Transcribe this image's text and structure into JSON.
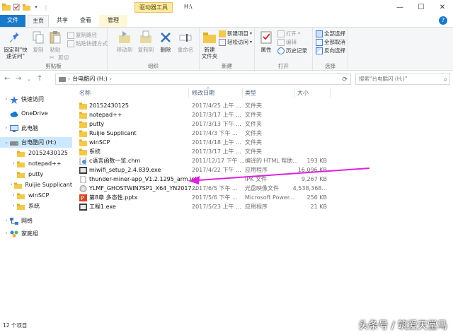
{
  "window": {
    "title": "H:\\",
    "context_tab": "驱动器工具"
  },
  "tabs": {
    "file": "文件",
    "home": "主页",
    "share": "共享",
    "view": "查看",
    "manage": "管理"
  },
  "ribbon": {
    "clipboard": {
      "label": "剪贴板",
      "pin": "固定到\"快速访问\"",
      "copy": "复制",
      "paste": "粘贴",
      "copy_path": "复制路径",
      "paste_shortcut": "粘贴快捷方式",
      "cut": "剪切"
    },
    "organize": {
      "label": "组织",
      "move_to": "移动到",
      "copy_to": "复制到",
      "delete": "删除",
      "rename": "重命名"
    },
    "new": {
      "label": "新建",
      "new_folder": "新建\n文件夹",
      "new_item": "新建项目",
      "easy_access": "轻松访问"
    },
    "open": {
      "label": "打开",
      "properties": "属性",
      "open": "打开",
      "edit": "编辑",
      "history": "历史记录"
    },
    "select": {
      "label": "选择",
      "select_all": "全部选择",
      "select_none": "全部取消",
      "invert": "反向选择"
    }
  },
  "address": {
    "path": "台电酷闪 (H:)",
    "search_placeholder": "搜索\"台电酷闪 (H:)\""
  },
  "nav": [
    {
      "label": "快速访问",
      "icon": "star-icon",
      "level": 0,
      "chev": "›"
    },
    {
      "label": "OneDrive",
      "icon": "cloud-icon",
      "level": 0,
      "chev": ""
    },
    {
      "label": "此电脑",
      "icon": "computer-icon",
      "level": 0,
      "chev": "›"
    },
    {
      "label": "台电酷闪 (H:)",
      "icon": "drive-icon",
      "level": 0,
      "chev": "⌄",
      "selected": true
    },
    {
      "label": "20152430125",
      "icon": "folder-icon",
      "level": 1,
      "chev": ""
    },
    {
      "label": "notepad++",
      "icon": "folder-icon",
      "level": 1,
      "chev": "›"
    },
    {
      "label": "putty",
      "icon": "folder-icon",
      "level": 1,
      "chev": ""
    },
    {
      "label": "Ruijie Supplicant",
      "icon": "folder-icon",
      "level": 1,
      "chev": "›"
    },
    {
      "label": "winSCP",
      "icon": "folder-icon",
      "level": 1,
      "chev": "›"
    },
    {
      "label": "系统",
      "icon": "folder-icon",
      "level": 1,
      "chev": "›"
    },
    {
      "label": "网络",
      "icon": "network-icon",
      "level": 0,
      "chev": "›"
    },
    {
      "label": "家庭组",
      "icon": "homegroup-icon",
      "level": 0,
      "chev": "›"
    }
  ],
  "columns": {
    "name": "名称",
    "date": "修改日期",
    "type": "类型",
    "size": "大小"
  },
  "files": [
    {
      "name": "20152430125",
      "date": "2017/4/25 上午 ...",
      "type": "文件夹",
      "size": "",
      "icon": "folder"
    },
    {
      "name": "notepad++",
      "date": "2017/3/17 上午 ...",
      "type": "文件夹",
      "size": "",
      "icon": "folder"
    },
    {
      "name": "putty",
      "date": "2017/3/13 下午 ...",
      "type": "文件夹",
      "size": "",
      "icon": "folder"
    },
    {
      "name": "Ruijie Supplicant",
      "date": "2017/4/3 下午 ...",
      "type": "文件夹",
      "size": "",
      "icon": "folder"
    },
    {
      "name": "winSCP",
      "date": "2017/4/18 上午 ...",
      "type": "文件夹",
      "size": "",
      "icon": "folder"
    },
    {
      "name": "系统",
      "date": "2017/3/17 上午 ...",
      "type": "文件夹",
      "size": "",
      "icon": "folder"
    },
    {
      "name": "c语言函数一览.chm",
      "date": "2011/12/17 下午 ...",
      "type": "编译的 HTML 帮助...",
      "size": "193 KB",
      "icon": "chm"
    },
    {
      "name": "miwifi_setup_2.4.839.exe",
      "date": "2017/4/22 下午 ...",
      "type": "应用程序",
      "size": "16,096 KB",
      "icon": "exe"
    },
    {
      "name": "thunder-miner-app_V1.2.1295_arm.ipk",
      "date": "",
      "type": "IPK 文件",
      "size": "9,267 KB",
      "icon": "file"
    },
    {
      "name": "YLMF_GHOSTWIN7SP1_X64_YN2017...",
      "date": "2017/6/5 下午 ...",
      "type": "光盘映像文件",
      "size": "4,538,368...",
      "icon": "iso"
    },
    {
      "name": "第8章 多态性.pptx",
      "date": "2017/5/6 下午 ...",
      "type": "Microsoft Power...",
      "size": "256 KB",
      "icon": "pptx"
    },
    {
      "name": "工程1.exe",
      "date": "2017/5/23 上午 ...",
      "type": "应用程序",
      "size": "21 KB",
      "icon": "exe"
    }
  ],
  "status": {
    "count": "12 个项目"
  },
  "watermark": "头条号 / 筑爱天堂马",
  "colors": {
    "accent": "#1979ca",
    "selection": "#cce8ff",
    "arrow": "#e020e0",
    "folder": "#f2c94c"
  }
}
